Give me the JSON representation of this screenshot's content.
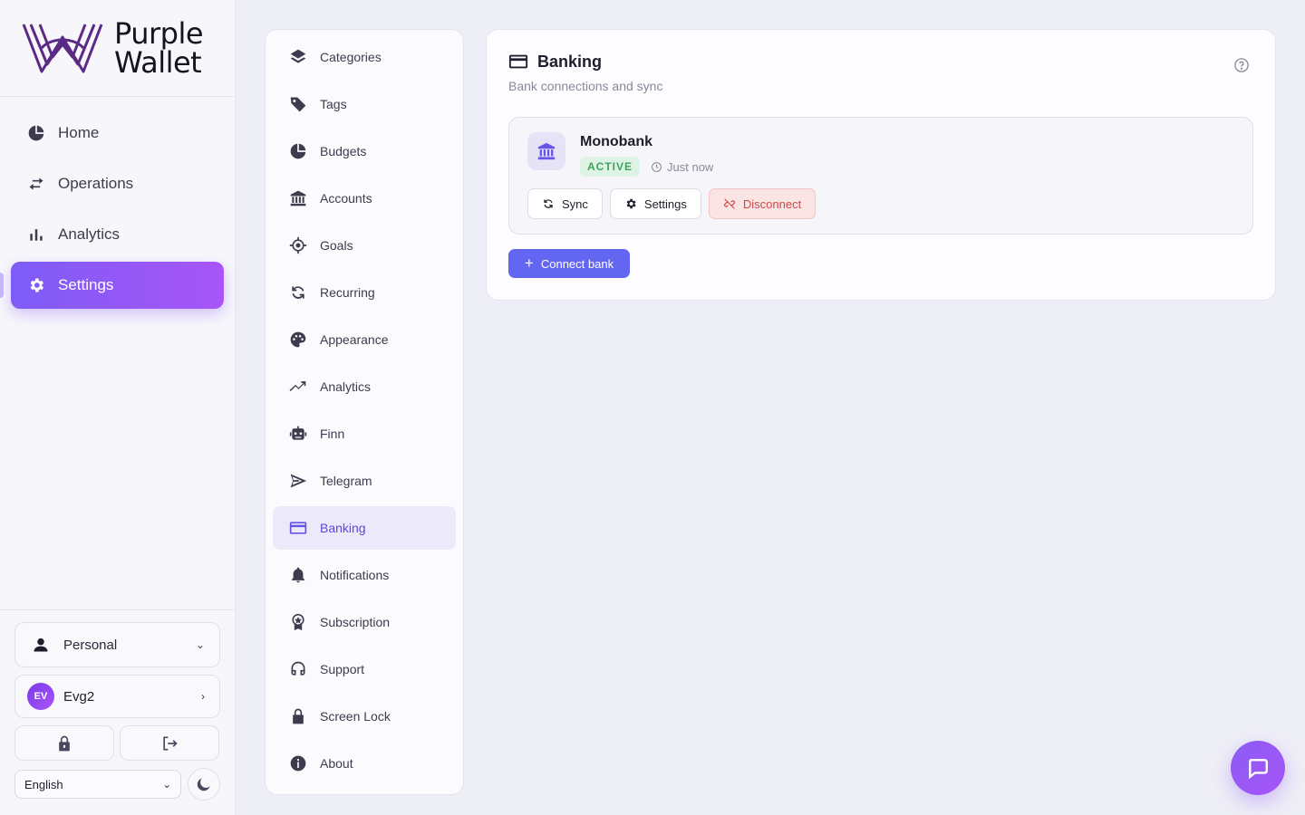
{
  "app": {
    "logo_text": "Purple\nWallet",
    "logo_line1": "Purple",
    "logo_line2": "Wallet",
    "accent": "#8b5cf6"
  },
  "main_nav": [
    {
      "label": "Home",
      "icon": "pie-chart-icon",
      "active": false
    },
    {
      "label": "Operations",
      "icon": "arrows-exchange-icon",
      "active": false
    },
    {
      "label": "Analytics",
      "icon": "bar-chart-icon",
      "active": false
    },
    {
      "label": "Settings",
      "icon": "gear-icon",
      "active": true
    }
  ],
  "sidebar_bottom": {
    "workspace": "Personal",
    "user_initials": "EV",
    "user_name": "Evg2",
    "language": "English"
  },
  "settings_nav": [
    {
      "label": "Categories",
      "icon": "layers-icon"
    },
    {
      "label": "Tags",
      "icon": "tag-icon"
    },
    {
      "label": "Budgets",
      "icon": "pie-chart-icon"
    },
    {
      "label": "Accounts",
      "icon": "bank-icon"
    },
    {
      "label": "Goals",
      "icon": "target-icon"
    },
    {
      "label": "Recurring",
      "icon": "sync-icon"
    },
    {
      "label": "Appearance",
      "icon": "palette-icon"
    },
    {
      "label": "Analytics",
      "icon": "trend-icon"
    },
    {
      "label": "Finn",
      "icon": "robot-icon"
    },
    {
      "label": "Telegram",
      "icon": "paper-plane-icon"
    },
    {
      "label": "Banking",
      "icon": "credit-card-icon",
      "active": true
    },
    {
      "label": "Notifications",
      "icon": "bell-icon"
    },
    {
      "label": "Subscription",
      "icon": "award-icon"
    },
    {
      "label": "Support",
      "icon": "headset-icon"
    },
    {
      "label": "Screen Lock",
      "icon": "lock-icon"
    },
    {
      "label": "About",
      "icon": "info-icon"
    }
  ],
  "banking": {
    "title": "Banking",
    "subtitle": "Bank connections and sync",
    "connection": {
      "name": "Monobank",
      "status": "ACTIVE",
      "status_color": "#3ba35d",
      "last_sync": "Just now",
      "actions": {
        "sync": "Sync",
        "settings": "Settings",
        "disconnect": "Disconnect"
      }
    },
    "connect_label": "Connect bank"
  }
}
